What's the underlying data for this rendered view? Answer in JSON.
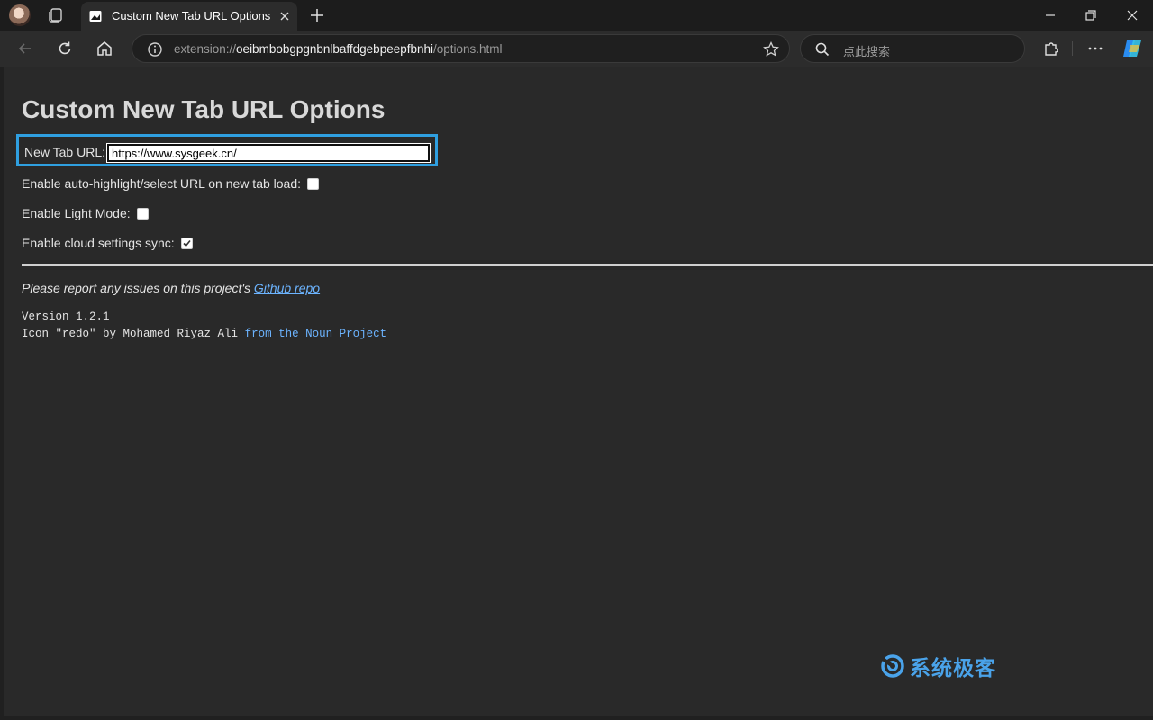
{
  "browser": {
    "tab": {
      "title": "Custom New Tab URL Options"
    },
    "address": {
      "scheme": "extension://",
      "host": "oeibmbobgpgnbnlbaffdgebpeepfbnhi",
      "path": "/options.html"
    },
    "search": {
      "placeholder": "点此搜索"
    },
    "accent_color": "#2f9fe0"
  },
  "page": {
    "heading": "Custom New Tab URL Options",
    "new_tab_url": {
      "label": "New Tab URL:",
      "value": "https://www.sysgeek.cn/"
    },
    "options": [
      {
        "label": "Enable auto-highlight/select URL on new tab load:",
        "checked": false
      },
      {
        "label": "Enable Light Mode:",
        "checked": false
      },
      {
        "label": "Enable cloud settings sync:",
        "checked": true
      }
    ],
    "report": {
      "text": "Please report any issues on this project's",
      "link": "Github repo"
    },
    "version": "Version 1.2.1",
    "credit": {
      "text": "Icon \"redo\" by Mohamed Riyaz Ali",
      "link": "from the Noun Project"
    }
  },
  "watermark": {
    "text": "系统极客"
  }
}
